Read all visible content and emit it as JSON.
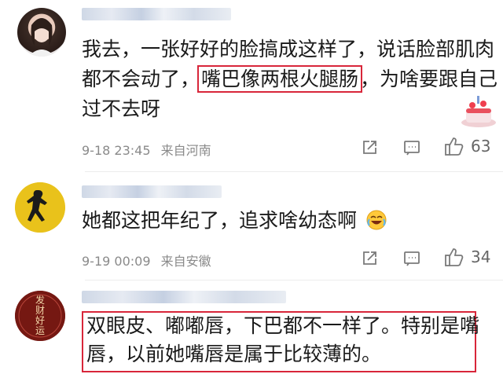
{
  "comments": [
    {
      "line1": "我去，一张好好的脸搞成这样了，说话脸部肌肉",
      "line2_pre": "都不会动了，",
      "line2_hl": "嘴巴像两根火腿肠",
      "line2_post": "，为啥要跟自己",
      "line3": "过不去呀",
      "date": "9-18 23:45",
      "location": "来自河南",
      "likes": "63",
      "icons": [
        "share-icon",
        "comment-icon",
        "thumbs-up-icon"
      ],
      "sticker": "cake-icon"
    },
    {
      "line1": "她都这把年纪了，追求啥幼态啊",
      "emoji": "laughing-crying-emoji-icon",
      "date": "9-19 00:09",
      "location": "来自安徽",
      "likes": "34",
      "icons": [
        "share-icon",
        "comment-icon",
        "thumbs-up-icon"
      ]
    },
    {
      "line1": "双眼皮、嘟嘟唇，下巴都不一样了。特别是嘴",
      "line2": "唇，以前她嘴唇是属于比较薄的。",
      "avatar_text": "发财好运"
    }
  ],
  "colors": {
    "highlight": "#d8263a",
    "meta": "#8a8a8a"
  }
}
